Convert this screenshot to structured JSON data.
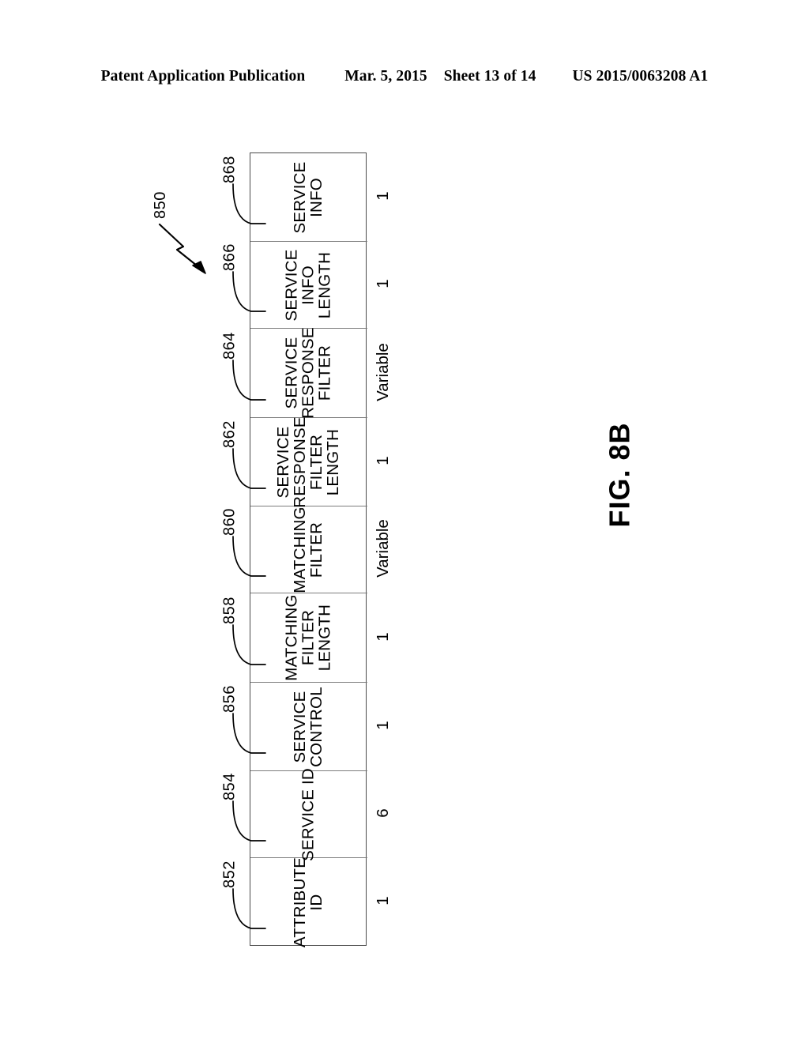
{
  "header": {
    "publication": "Patent Application Publication",
    "date": "Mar. 5, 2015",
    "sheet": "Sheet 13 of 14",
    "pub_number": "US 2015/0063208 A1"
  },
  "figure": {
    "caption": "FIG. 8B",
    "diagram_ref": "850",
    "size_row_title": "",
    "fields": [
      {
        "ref": "852",
        "label_lines": [
          "ATTRIBUTE",
          "ID"
        ],
        "label": "ATTRIBUTE ID",
        "size": "1"
      },
      {
        "ref": "854",
        "label_lines": [
          "SERVICE ID"
        ],
        "label": "SERVICE ID",
        "size": "6"
      },
      {
        "ref": "856",
        "label_lines": [
          "SERVICE",
          "CONTROL"
        ],
        "label": "SERVICE CONTROL",
        "size": "1"
      },
      {
        "ref": "858",
        "label_lines": [
          "MATCHING",
          "FILTER",
          "LENGTH"
        ],
        "label": "MATCHING FILTER LENGTH",
        "size": "1"
      },
      {
        "ref": "860",
        "label_lines": [
          "MATCHING",
          "FILTER"
        ],
        "label": "MATCHING FILTER",
        "size": "Variable"
      },
      {
        "ref": "862",
        "label_lines": [
          "SERVICE",
          "RESPONSE",
          "FILTER",
          "LENGTH"
        ],
        "label": "SERVICE RESPONSE FILTER LENGTH",
        "size": "1"
      },
      {
        "ref": "864",
        "label_lines": [
          "SERVICE",
          "RESPONSE",
          "FILTER"
        ],
        "label": "SERVICE RESPONSE FILTER",
        "size": "Variable"
      },
      {
        "ref": "866",
        "label_lines": [
          "SERVICE",
          "INFO",
          "LENGTH"
        ],
        "label": "SERVICE INFO LENGTH",
        "size": "1"
      },
      {
        "ref": "868",
        "label_lines": [
          "SERVICE",
          "INFO"
        ],
        "label": "SERVICE INFO",
        "size": "1"
      }
    ]
  },
  "colors": {
    "ink": "#000000",
    "table_border": "#4a4a4a",
    "cell_divider": "#7d7d7d",
    "page_background": "#ffffff"
  }
}
